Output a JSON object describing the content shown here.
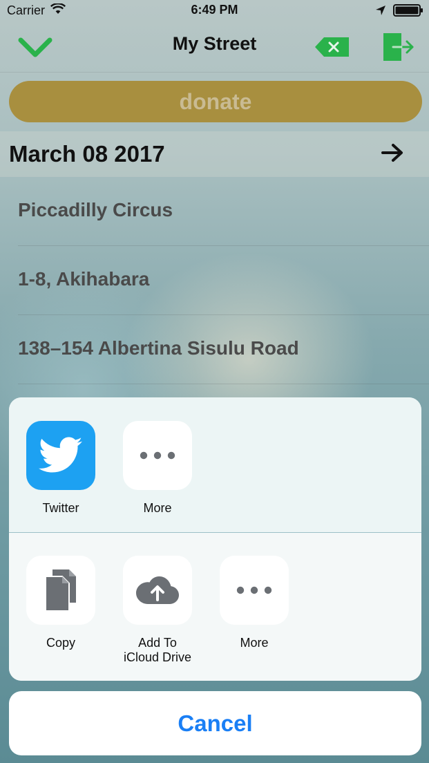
{
  "status_bar": {
    "carrier": "Carrier",
    "time": "6:49 PM"
  },
  "nav": {
    "title": "My Street",
    "icons": [
      "checkmark-icon",
      "delete-icon",
      "exit-icon"
    ]
  },
  "donate": {
    "label": "donate"
  },
  "date_header": {
    "date": "March 08 2017"
  },
  "list": {
    "items": [
      {
        "label": "Piccadilly Circus"
      },
      {
        "label": "1-8, Akihabara"
      },
      {
        "label": "138–154 Albertina Sisulu Road"
      }
    ]
  },
  "share_sheet": {
    "apps": [
      {
        "label": "Twitter",
        "icon": "twitter-icon"
      },
      {
        "label": "More",
        "icon": "more-icon"
      }
    ],
    "actions": [
      {
        "label": "Copy",
        "icon": "copy-icon"
      },
      {
        "label_line1": "Add To",
        "label_line2": "iCloud Drive",
        "icon": "icloud-upload-icon"
      },
      {
        "label": "More",
        "icon": "more-icon"
      }
    ],
    "cancel_label": "Cancel"
  },
  "colors": {
    "accent_green": "#2ab24b",
    "donate_bg": "#a88f3f",
    "twitter_blue": "#1da1f2",
    "cancel_blue": "#1a7ff5"
  }
}
